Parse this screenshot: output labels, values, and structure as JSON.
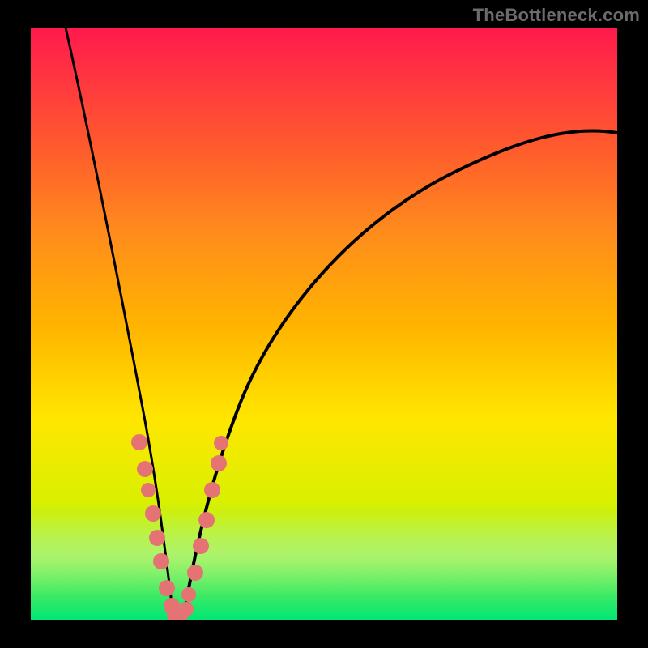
{
  "watermark": "TheBottleneck.com",
  "colors": {
    "background": "#000000",
    "gradient_top": "#ff1a4d",
    "gradient_bottom": "#00e676",
    "curve": "#000000",
    "dots": "#e57373"
  },
  "chart_data": {
    "type": "line",
    "title": "",
    "xlabel": "",
    "ylabel": "",
    "xlim": [
      0,
      100
    ],
    "ylim": [
      0,
      100
    ],
    "grid": false,
    "series": [
      {
        "name": "left-curve",
        "x": [
          6,
          8,
          10,
          12,
          14,
          16,
          18,
          19,
          20,
          21,
          22,
          23,
          24
        ],
        "y": [
          100,
          88,
          76,
          65,
          54,
          43,
          33,
          27,
          21,
          15,
          10,
          5,
          0
        ]
      },
      {
        "name": "right-curve",
        "x": [
          26,
          27,
          28,
          30,
          32,
          35,
          40,
          50,
          60,
          70,
          80,
          90,
          100
        ],
        "y": [
          0,
          4,
          8,
          16,
          23,
          32,
          43,
          58,
          67,
          73,
          77,
          80,
          82
        ]
      }
    ],
    "dots": {
      "name": "marked-points",
      "x": [
        18.5,
        19.5,
        20.0,
        20.8,
        21.5,
        22.3,
        23.2,
        24.0,
        24.5,
        25.5,
        26.5,
        27.0,
        28.0,
        29.0,
        30.0,
        31.0,
        32.0,
        32.5
      ],
      "y": [
        30,
        25.5,
        22,
        18,
        14,
        10,
        5.5,
        2.5,
        1,
        1,
        2,
        4.5,
        8,
        12.5,
        17,
        22,
        26.5,
        30
      ]
    },
    "vertex_x": 25
  }
}
